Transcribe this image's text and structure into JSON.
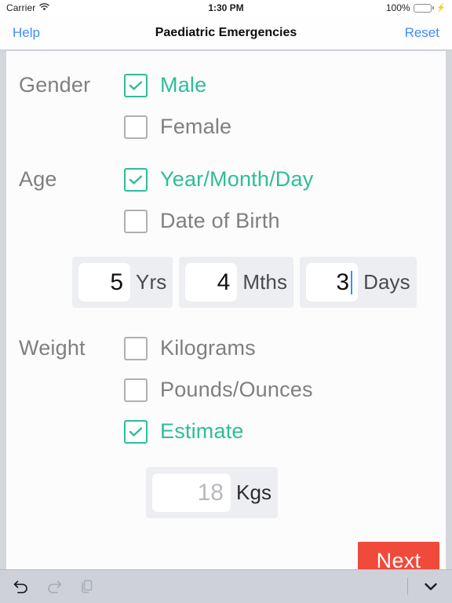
{
  "statusbar": {
    "carrier": "Carrier",
    "wifi_icon": "wifi-icon",
    "time": "1:30 PM",
    "battery_percent": "100%",
    "battery_icon": "battery-full-charging-icon",
    "charging_icon": "lightning-bolt-icon"
  },
  "navbar": {
    "left_label": "Help",
    "title": "Paediatric Emergencies",
    "right_label": "Reset"
  },
  "colors": {
    "accent_green": "#2fbd9b",
    "ios_blue": "#3c8cff",
    "next_red": "#ef4a3c",
    "label_gray": "#7f7f7f",
    "checkbox_gray": "#aeb0b3",
    "field_bg": "#eceef2",
    "content_bg": "#fbfcfb",
    "toolbar_bg": "#ced2d8",
    "battery_green": "#4cd964"
  },
  "form": {
    "gender": {
      "label": "Gender",
      "options": [
        {
          "label": "Male",
          "checked": true
        },
        {
          "label": "Female",
          "checked": false
        }
      ]
    },
    "age": {
      "label": "Age",
      "options": [
        {
          "label": "Year/Month/Day",
          "checked": true
        },
        {
          "label": "Date of Birth",
          "checked": false
        }
      ],
      "fields": [
        {
          "value": "5",
          "unit": "Yrs",
          "focused": false,
          "placeholder": ""
        },
        {
          "value": "4",
          "unit": "Mths",
          "focused": false,
          "placeholder": ""
        },
        {
          "value": "3",
          "unit": "Days",
          "focused": true,
          "placeholder": ""
        }
      ]
    },
    "weight": {
      "label": "Weight",
      "options": [
        {
          "label": "Kilograms",
          "checked": false
        },
        {
          "label": "Pounds/Ounces",
          "checked": false
        },
        {
          "label": "Estimate",
          "checked": true
        }
      ],
      "fields": [
        {
          "value": "",
          "placeholder": "18",
          "unit": "Kgs",
          "focused": false
        }
      ]
    },
    "next_label": "Next"
  },
  "keyboard_toolbar": {
    "undo_icon": "undo-arrow-icon",
    "redo_icon": "redo-arrow-icon",
    "paste_icon": "paste-copy-icon",
    "dismiss_icon": "chevron-down-icon"
  }
}
